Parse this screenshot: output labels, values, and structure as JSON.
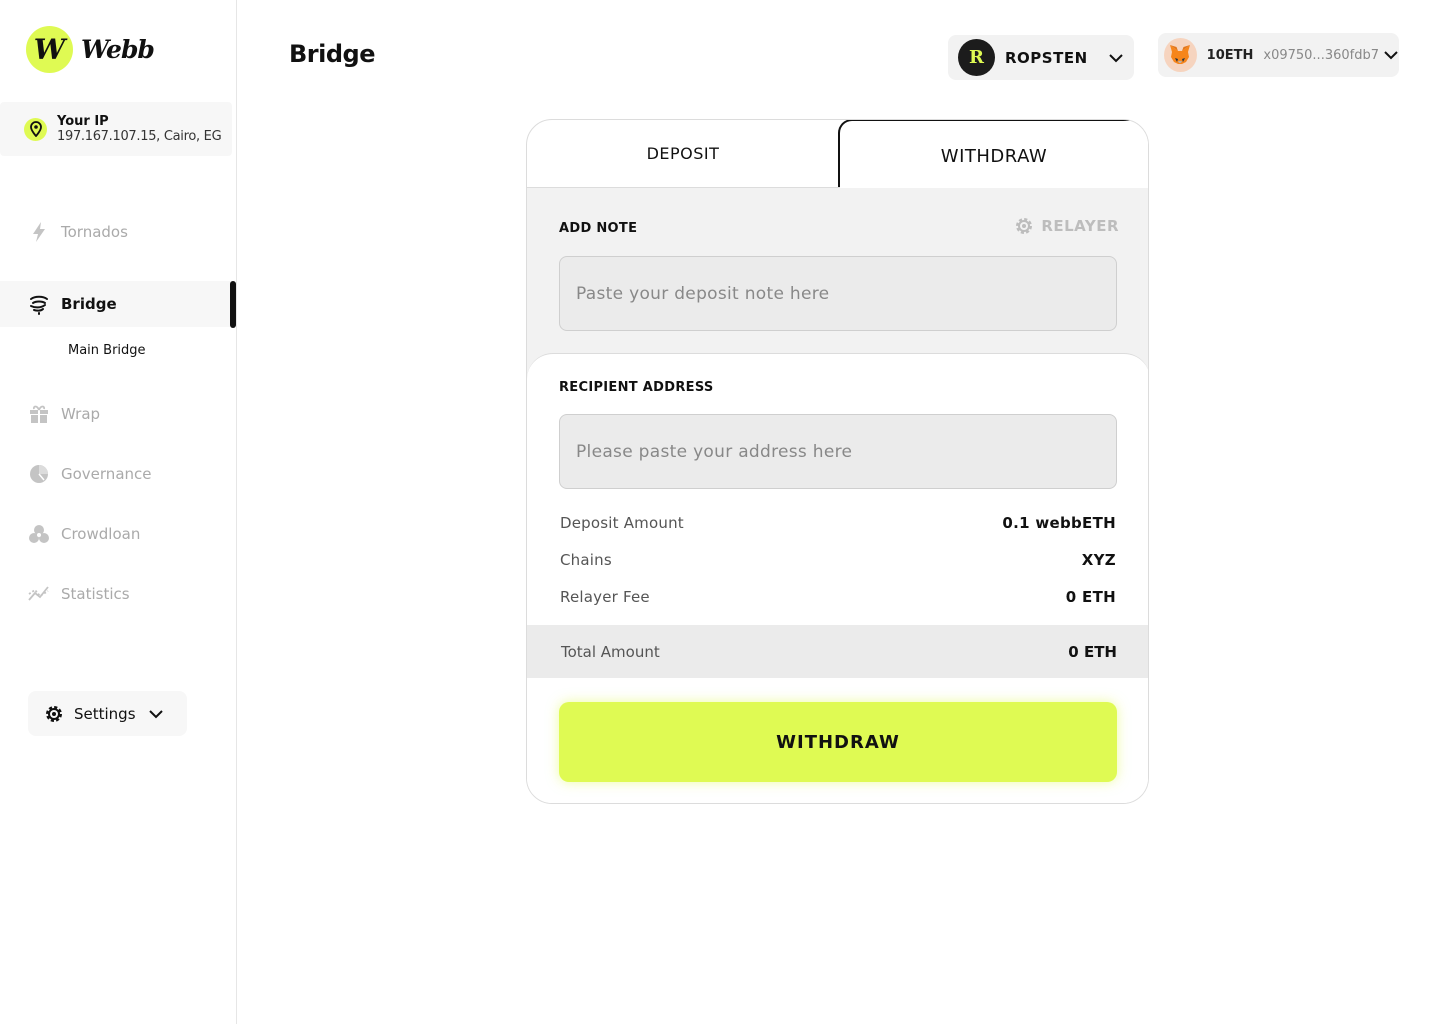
{
  "brand": {
    "logo_mark": "W",
    "name": "Webb",
    "accent": "#DFFA53"
  },
  "ip": {
    "title": "Your IP",
    "value": "197.167.107.15, Cairo, EG"
  },
  "nav": {
    "items": [
      {
        "label": "Tornados",
        "icon": "lightning-icon"
      },
      {
        "label": "Bridge",
        "icon": "bridge-icon",
        "active": true
      },
      {
        "label": "Wrap",
        "icon": "gift-icon"
      },
      {
        "label": "Governance",
        "icon": "pie-chart-icon"
      },
      {
        "label": "Crowdloan",
        "icon": "coins-icon"
      },
      {
        "label": "Statistics",
        "icon": "line-chart-icon"
      }
    ],
    "sub_items": [
      {
        "label": "Main Bridge"
      }
    ]
  },
  "settings": {
    "label": "Settings"
  },
  "header": {
    "title": "Bridge",
    "network": {
      "badge": "R",
      "name": "ROPSTEN"
    },
    "wallet": {
      "balance": "10ETH",
      "address": "x09750...360fdb7"
    }
  },
  "card": {
    "tabs": {
      "deposit": "DEPOSIT",
      "withdraw": "WITHDRAW"
    },
    "note": {
      "label": "ADD NOTE",
      "relayer": "RELAYER",
      "placeholder": "Paste your deposit note here"
    },
    "recipient": {
      "label": "RECIPIENT ADDRESS",
      "placeholder": "Please paste your address here"
    },
    "details": [
      {
        "key": "Deposit Amount",
        "value": "0.1 webbETH"
      },
      {
        "key": "Chains",
        "value": "XYZ"
      },
      {
        "key": "Relayer Fee",
        "value": "0 ETH"
      }
    ],
    "total": {
      "key": "Total Amount",
      "value": "0 ETH"
    },
    "submit_label": "WITHDRAW"
  }
}
